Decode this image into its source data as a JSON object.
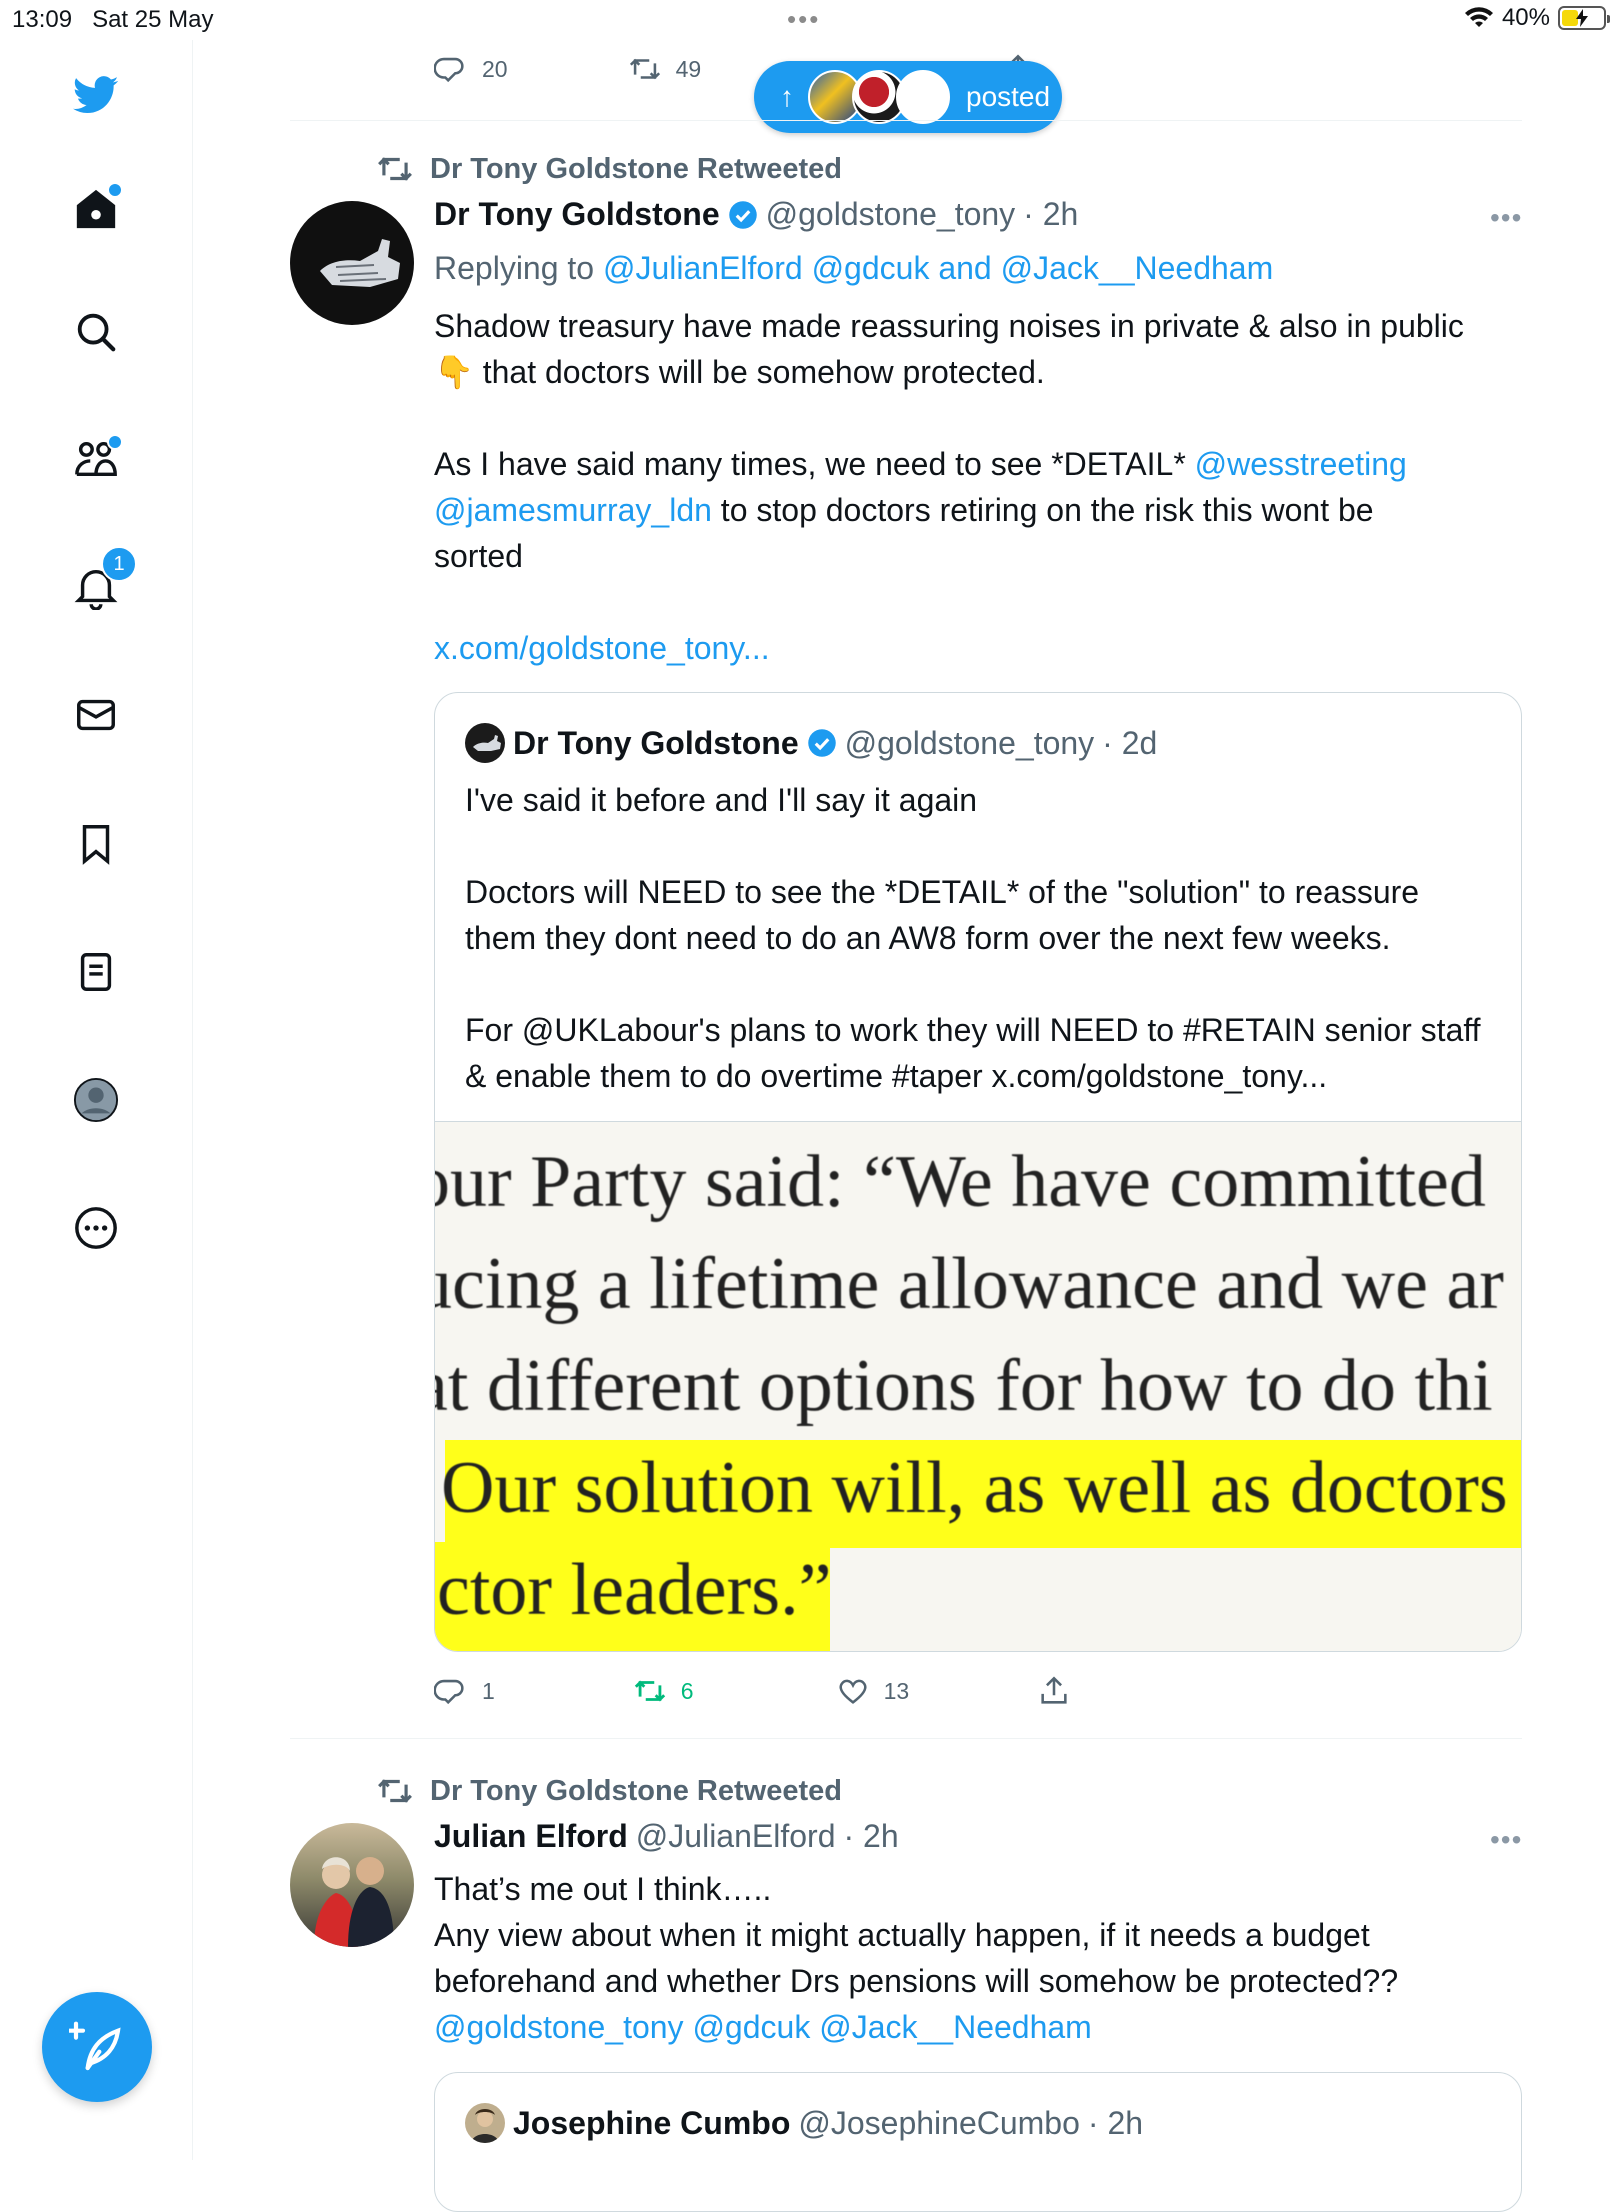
{
  "status_bar": {
    "time": "13:09",
    "date": "Sat 25 May",
    "battery_percent": "40%",
    "battery_level": 0.4
  },
  "sidebar": {
    "items": [
      {
        "icon": "twitter-logo-icon"
      },
      {
        "icon": "home-icon",
        "has_dot": true
      },
      {
        "icon": "search-icon"
      },
      {
        "icon": "communities-icon",
        "has_dot": true
      },
      {
        "icon": "notifications-icon",
        "badge": "1"
      },
      {
        "icon": "messages-icon"
      },
      {
        "icon": "bookmarks-icon"
      },
      {
        "icon": "lists-icon"
      },
      {
        "icon": "profile-icon"
      },
      {
        "icon": "more-icon"
      }
    ],
    "compose_icon": "compose-feather-icon"
  },
  "new_posts_pill": {
    "label": "posted",
    "arrow": "↑"
  },
  "top_actions": {
    "replies": "20",
    "retweets": "49"
  },
  "tweets": [
    {
      "retweeted_by": "Dr Tony Goldstone Retweeted",
      "name": "Dr Tony Goldstone",
      "handle": "@goldstone_tony",
      "time": "· 2h",
      "verified": true,
      "replying_prefix": "Replying to ",
      "replying_to": "@JulianElford @gdcuk and @Jack__Needham",
      "line1": "Shadow treasury have made reassuring noises in private & also in public",
      "line2_emoji": "👇",
      "line2": " that doctors will be somehow protected.",
      "para2_a": "As I have said many times, we need to see *DETAIL* ",
      "para2_mention1": "@wesstreeting",
      "para2_mention2": "@jamesmurray_ldn",
      "para2_b": " to stop doctors retiring on the risk this wont be",
      "para2_c": "sorted",
      "link": "x.com/goldstone_tony...",
      "quote": {
        "name": "Dr Tony Goldstone",
        "handle": "@goldstone_tony",
        "time": "· 2d",
        "verified": true,
        "p1": "I've said it before and I'll say it again",
        "p2": "Doctors will NEED to see the *DETAIL* of the \"solution\" to reassure them they dont need to do an AW8 form over the next few weeks.",
        "p3": "For @UKLabour's plans to work they will NEED to #RETAIN senior staff & enable them to do overtime #taper x.com/goldstone_tony...",
        "image_lines": [
          "our Party said: “We have committed",
          "ucing a lifetime allowance and we ar",
          "at different options for how to do thi",
          "Our solution will, as well as doctors",
          "ctor leaders.”"
        ]
      },
      "actions": {
        "replies": "1",
        "retweets": "6",
        "likes": "13"
      }
    },
    {
      "retweeted_by": "Dr Tony Goldstone Retweeted",
      "name": "Julian Elford",
      "handle": "@JulianElford",
      "time": "· 2h",
      "line1": "That’s me out I think…..",
      "line2": "Any view about when it might actually happen, if it needs a budget",
      "line3": "beforehand and whether Drs pensions will somehow be protected??",
      "mentions": "@goldstone_tony @gdcuk @Jack__Needham",
      "quote": {
        "name": "Josephine Cumbo",
        "handle": "@JosephineCumbo",
        "time": "· 2h"
      }
    }
  ],
  "colors": {
    "accent": "#1d9bf0",
    "retweet_active": "#00ba7c",
    "secondary_text": "#536471",
    "highlight": "#ffff1a"
  }
}
